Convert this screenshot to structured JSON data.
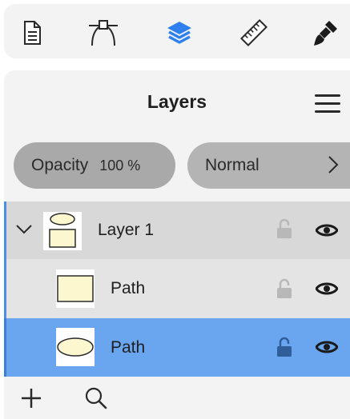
{
  "toolbar": {
    "tools": [
      {
        "icon": "document-icon",
        "active": false
      },
      {
        "icon": "pen-tool-icon",
        "active": false
      },
      {
        "icon": "layers-icon",
        "active": true
      },
      {
        "icon": "ruler-icon",
        "active": false
      },
      {
        "icon": "brush-icon",
        "active": false
      }
    ],
    "active_color": "#2f80ed"
  },
  "panel": {
    "title": "Layers",
    "opacity_label": "Opacity",
    "opacity_value": "100 %",
    "blend_mode": "Normal"
  },
  "layers": [
    {
      "name": "Layer 1",
      "kind": "group",
      "expanded": true,
      "locked": false,
      "visible": true,
      "selected": false
    },
    {
      "name": "Path",
      "kind": "rectangle",
      "locked": false,
      "visible": true,
      "selected": false
    },
    {
      "name": "Path",
      "kind": "ellipse",
      "locked": false,
      "visible": true,
      "selected": true
    }
  ],
  "colors": {
    "panel_bg": "#f3f3f3",
    "group_row": "#d8d8d8",
    "child_row": "#e4e4e4",
    "selected_row": "#6aa6f0",
    "accent": "#4a90e2",
    "shape_fill": "#fdf7cf"
  }
}
